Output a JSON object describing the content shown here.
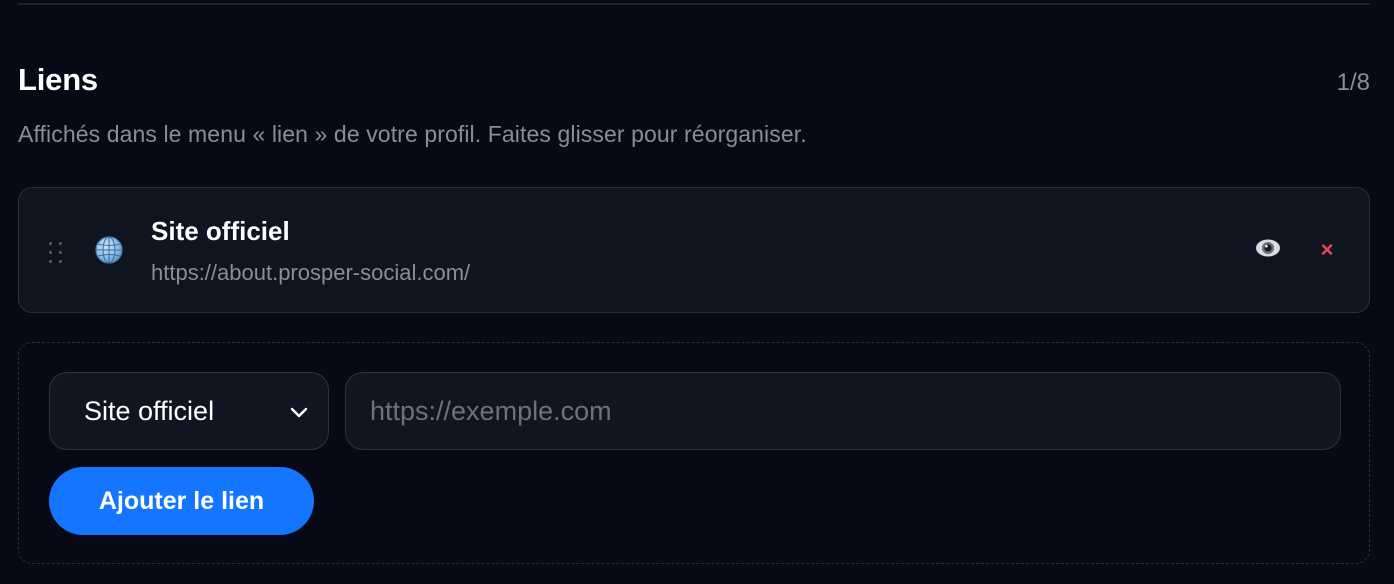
{
  "section": {
    "title": "Liens",
    "count": "1/8",
    "description": "Affichés dans le menu « lien » de votre profil. Faites glisser pour réorganiser."
  },
  "links": [
    {
      "icon": "globe-icon",
      "name": "Site officiel",
      "url": "https://about.prosper-social.com/",
      "visibility_icon": "eye-icon",
      "remove_icon": "close-icon",
      "remove_label": "×"
    }
  ],
  "add_form": {
    "type_select": {
      "selected": "Site officiel"
    },
    "url_input": {
      "value": "",
      "placeholder": "https://exemple.com"
    },
    "submit_label": "Ajouter le lien"
  },
  "colors": {
    "background": "#070a16",
    "card": "#101320",
    "border": "#2b2e3b",
    "accent": "#1476ff",
    "danger": "#e8445a",
    "muted_text": "#8a8d99"
  }
}
